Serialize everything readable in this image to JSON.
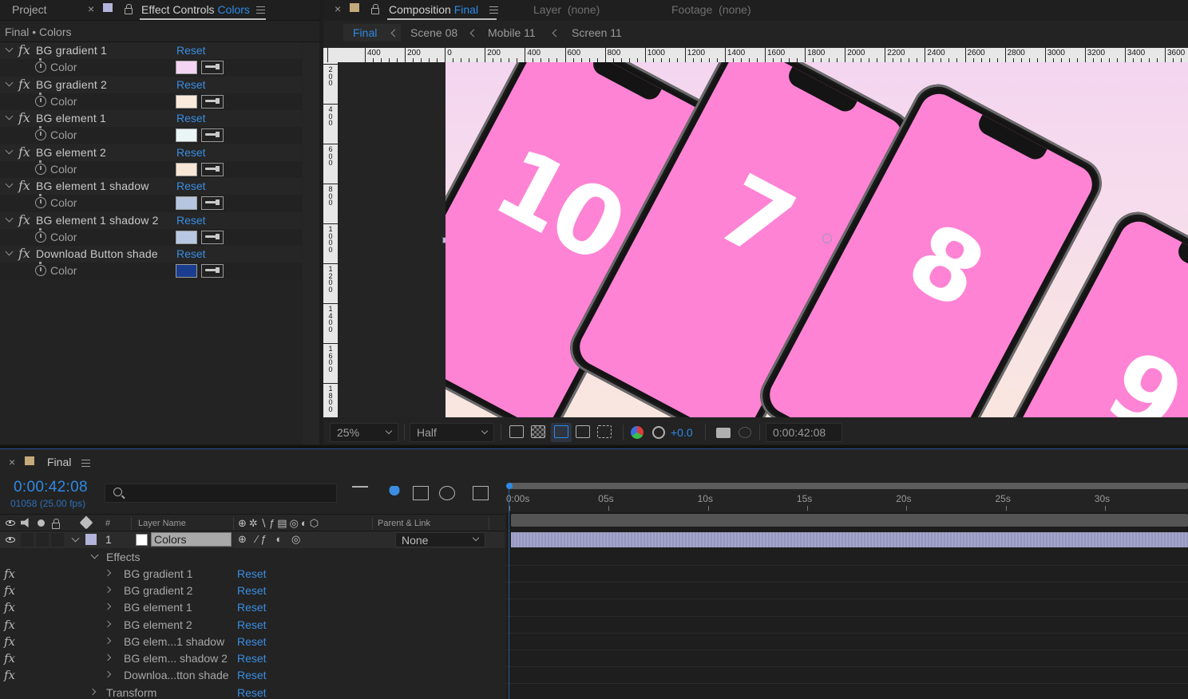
{
  "left_tabs": {
    "project": "Project",
    "effect_controls_prefix": "Effect Controls",
    "effect_controls_layer": "Colors",
    "close": "×"
  },
  "effect_controls": {
    "subtitle": "Final • Colors",
    "effects": [
      {
        "name": "BG gradient 1",
        "reset": "Reset",
        "param": "Color",
        "color": "#f4d4f2"
      },
      {
        "name": "BG gradient 2",
        "reset": "Reset",
        "param": "Color",
        "color": "#faeadb"
      },
      {
        "name": "BG element 1",
        "reset": "Reset",
        "param": "Color",
        "color": "#eaf6f6"
      },
      {
        "name": "BG element 2",
        "reset": "Reset",
        "param": "Color",
        "color": "#f8e6d6"
      },
      {
        "name": "BG element 1 shadow",
        "reset": "Reset",
        "param": "Color",
        "color": "#b7c6e0"
      },
      {
        "name": "BG element 1 shadow 2",
        "reset": "Reset",
        "param": "Color",
        "color": "#b8c8e2"
      },
      {
        "name": "Download Button shade",
        "reset": "Reset",
        "param": "Color",
        "color": "#1a3d8f"
      }
    ]
  },
  "comp_tabs": {
    "composition_prefix": "Composition",
    "composition_name": "Final",
    "layer": "Layer",
    "layer_value": "(none)",
    "footage": "Footage",
    "footage_value": "(none)",
    "close": "×"
  },
  "breadcrumbs": [
    "Final",
    "Scene 08",
    "Mobile 11",
    "Screen 11"
  ],
  "ruler_top": [
    "400",
    "200",
    "0",
    "200",
    "400",
    "600",
    "800",
    "1000",
    "1200",
    "1400",
    "1600",
    "1800",
    "2000",
    "2200",
    "2400",
    "2600",
    "2800",
    "3000",
    "3200",
    "3400",
    "3600"
  ],
  "ruler_left": [
    "200",
    "400",
    "600",
    "800",
    "1000",
    "1200",
    "1400",
    "1600",
    "1800"
  ],
  "phones": [
    "10",
    "7",
    "8",
    "9"
  ],
  "viewer": {
    "zoom": "25%",
    "resolution": "Half",
    "exposure": "+0.0",
    "timecode": "0:00:42:08"
  },
  "timeline": {
    "tab_name": "Final",
    "close": "×",
    "timecode": "0:00:42:08",
    "frames": "01058 (25.00 fps)",
    "col_num": "#",
    "col_layer_name": "Layer Name",
    "col_parent": "Parent & Link",
    "layer": {
      "index": "1",
      "name": "Colors",
      "parent": "None",
      "label_color": "#b3b3dc"
    },
    "effects_group": "Effects",
    "effect_rows": [
      {
        "name": "BG gradient 1",
        "reset": "Reset"
      },
      {
        "name": "BG gradient 2",
        "reset": "Reset"
      },
      {
        "name": "BG element 1",
        "reset": "Reset"
      },
      {
        "name": "BG element 2",
        "reset": "Reset"
      },
      {
        "name": "BG elem...1 shadow",
        "reset": "Reset"
      },
      {
        "name": "BG elem... shadow 2",
        "reset": "Reset"
      },
      {
        "name": "Downloa...tton shade",
        "reset": "Reset"
      }
    ],
    "transform": {
      "name": "Transform",
      "reset": "Reset"
    },
    "time_marks": [
      "0:00s",
      "05s",
      "10s",
      "15s",
      "20s",
      "25s",
      "30s"
    ]
  },
  "colors": {
    "accent_blue": "#2e8ae6",
    "phone_screen": "#fe83d4",
    "layer_bar": "#9e9fc9"
  }
}
